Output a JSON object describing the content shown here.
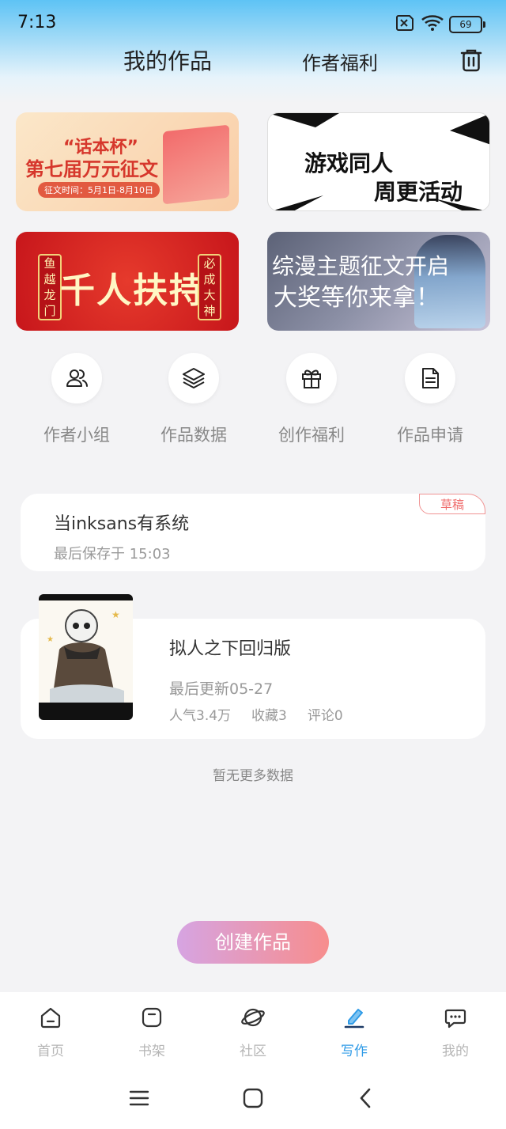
{
  "status": {
    "time": "7:13",
    "battery": "69"
  },
  "header": {
    "title": "我的作品",
    "subtitle": "作者福利"
  },
  "banners": {
    "b1": {
      "line1": "“话本杯”",
      "line2": "第七届万元征文",
      "line3": "征文时间：5月1日-8月10日"
    },
    "b2": {
      "line1": "游戏同人",
      "line2": "周更活动"
    },
    "b3": {
      "main": "千人扶持",
      "left": "鱼越龙门",
      "right": "必成大神"
    },
    "b4": {
      "line1": "综漫主题征文开启",
      "line2": "大奖等你来拿！"
    }
  },
  "quick_actions": [
    {
      "label": "作者小组",
      "icon": "group-icon"
    },
    {
      "label": "作品数据",
      "icon": "layers-icon"
    },
    {
      "label": "创作福利",
      "icon": "gift-icon"
    },
    {
      "label": "作品申请",
      "icon": "document-icon"
    }
  ],
  "draft": {
    "title": "当inksans有系统",
    "saved": "最后保存于 15:03",
    "tag": "草稿"
  },
  "work": {
    "title": "拟人之下回归版",
    "updated": "最后更新05-27",
    "popularity": "人气3.4万",
    "favorites": "收藏3",
    "comments": "评论0"
  },
  "no_more": "暂无更多数据",
  "create_button": "创建作品",
  "tabs": [
    {
      "label": "首页",
      "icon": "home-icon"
    },
    {
      "label": "书架",
      "icon": "bookshelf-icon"
    },
    {
      "label": "社区",
      "icon": "planet-icon"
    },
    {
      "label": "写作",
      "icon": "pen-icon",
      "active": true
    },
    {
      "label": "我的",
      "icon": "chat-icon"
    }
  ],
  "colors": {
    "accent": "#2f9be7",
    "draft_tag": "#ef6b6b",
    "create_start": "#d6a4e2",
    "create_end": "#f78d8d"
  }
}
